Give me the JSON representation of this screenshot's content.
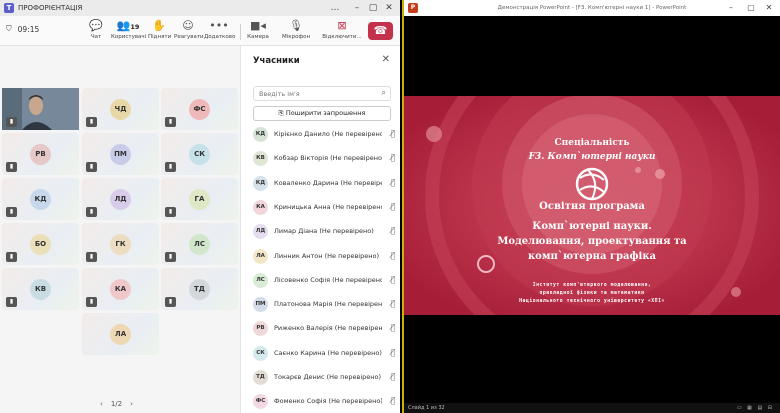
{
  "teams": {
    "title": "ПРОФОРІЄНТАЦІЯ",
    "timer": "09:15",
    "toolbar": [
      {
        "label": "Чат",
        "icon": "chat-icon"
      },
      {
        "label": "Користувачі",
        "icon": "people-icon",
        "badge": "19"
      },
      {
        "label": "Підняти",
        "icon": "raise-hand-icon"
      },
      {
        "label": "Реагувати",
        "icon": "react-icon"
      },
      {
        "label": "Додатково",
        "icon": "more-icon"
      },
      {
        "label": "Камера",
        "icon": "camera-icon"
      },
      {
        "label": "Мікрофон",
        "icon": "mic-icon"
      },
      {
        "label": "Відключити...",
        "icon": "share-icon"
      }
    ],
    "tiles": [
      "ЧД",
      "ФС",
      "РВ",
      "ПМ",
      "СК",
      "КД",
      "ЛД",
      "ГА",
      "БО",
      "ГК",
      "ЛС",
      "КВ",
      "КА",
      "ТД",
      "ЛА"
    ],
    "pager": "1/2",
    "participants": {
      "title": "Учасники",
      "search_placeholder": "Введіть ім'я",
      "share_label": "Поширити запрошення",
      "list": [
        {
          "initials": "КД",
          "name": "Кірієнко Данило (Не перевірено)"
        },
        {
          "initials": "КВ",
          "name": "Кобзар Вікторія (Не перевірено)"
        },
        {
          "initials": "КД",
          "name": "Коваленко Дарина (Не перевірено)"
        },
        {
          "initials": "КА",
          "name": "Криницька Анна (Не перевірено)"
        },
        {
          "initials": "ЛД",
          "name": "Лимар Діана (Не перевірено)"
        },
        {
          "initials": "ЛА",
          "name": "Линник Антон (Не перевірено)"
        },
        {
          "initials": "ЛС",
          "name": "Лісовенко Софія (Не перевірено)"
        },
        {
          "initials": "ПМ",
          "name": "Платонова Марія (Не перевірено)"
        },
        {
          "initials": "РВ",
          "name": "Риженко Валерія (Не перевірено)"
        },
        {
          "initials": "СК",
          "name": "Саєнко Карина (Не перевірено)"
        },
        {
          "initials": "ТД",
          "name": "Токарєв Денис (Не перевірено)"
        },
        {
          "initials": "ФС",
          "name": "Фоменко Софія (Не перевірено)"
        }
      ]
    }
  },
  "ppt": {
    "title": "Демонстрація PowerPoint - [F3. Комп'ютерні науки 1] - PowerPoint",
    "slide": {
      "line1": "Спеціальність",
      "line2": "F3. Комп`ютерні науки",
      "line3": "Освітня програма",
      "line4": "Комп`ютерні науки.",
      "line5": "Моделювання,  проектування та",
      "line6": "комп`ютерна графіка",
      "footer1": "Інститут комп'ютерного моделювання,",
      "footer2": "прикладної фізики та математики",
      "footer3": "Національного технічного університету «ХПІ»"
    },
    "status": "Слайд 1 из 32"
  }
}
